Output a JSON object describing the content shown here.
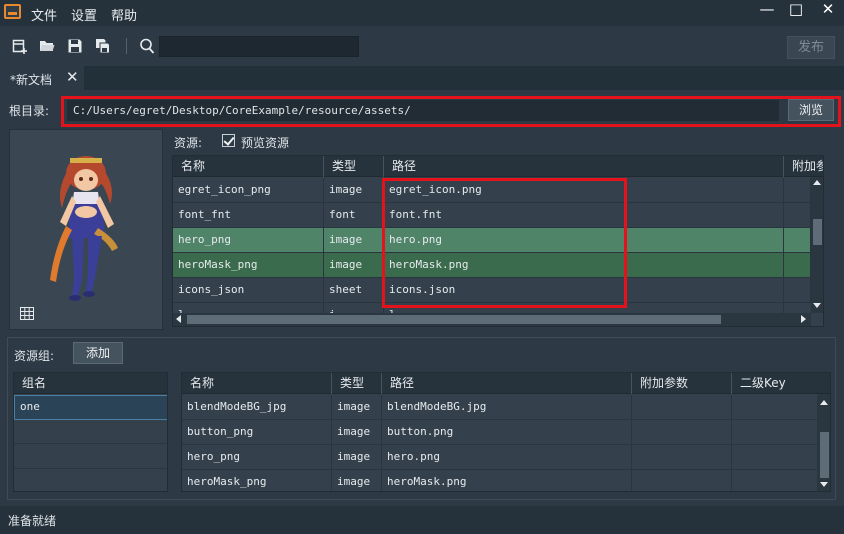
{
  "menu": {
    "file": "文件",
    "settings": "设置",
    "help": "帮助"
  },
  "window_controls": {
    "minimize": "—",
    "maximize": "□",
    "close": "✕"
  },
  "toolbar": {
    "icons": [
      "new-document-icon",
      "open-folder-icon",
      "save-icon",
      "save-all-icon",
      "search-icon"
    ],
    "search_value": "",
    "publish_label": "发布"
  },
  "tab": {
    "label": "*新文档",
    "close": "✕"
  },
  "root": {
    "label": "根目录:",
    "path": "C:/Users/egret/Desktop/CoreExample/resource/assets/",
    "browse_label": "浏览"
  },
  "resources": {
    "label": "资源:",
    "preview_label": "预览资源",
    "preview_checked": true,
    "columns": [
      "名称",
      "类型",
      "路径",
      "附加参"
    ],
    "rows": [
      {
        "name": "egret_icon_png",
        "type": "image",
        "path": "egret_icon.png",
        "state": "normal"
      },
      {
        "name": "font_fnt",
        "type": "font",
        "path": "font.fnt",
        "state": "normal"
      },
      {
        "name": "hero_png",
        "type": "image",
        "path": "hero.png",
        "state": "selected"
      },
      {
        "name": "heroMask_png",
        "type": "image",
        "path": "heroMask.png",
        "state": "highlight"
      },
      {
        "name": "icons_json",
        "type": "sheet",
        "path": "icons.json",
        "state": "normal"
      }
    ]
  },
  "groups": {
    "label": "资源组:",
    "add_label": "添加",
    "list_header": "组名",
    "items": [
      "one"
    ],
    "columns": [
      "名称",
      "类型",
      "路径",
      "附加参数",
      "二级Key"
    ],
    "rows": [
      {
        "name": "blendModeBG_jpg",
        "type": "image",
        "path": "blendModeBG.jpg"
      },
      {
        "name": "button_png",
        "type": "image",
        "path": "button.png"
      },
      {
        "name": "hero_png",
        "type": "image",
        "path": "hero.png"
      },
      {
        "name": "heroMask_png",
        "type": "image",
        "path": "heroMask.png"
      }
    ]
  },
  "status": {
    "text": "准备就绪"
  },
  "colors": {
    "accent_orange": "#e9892e",
    "highlight_red": "#e3121b",
    "selected_row": "#4f8469",
    "highlight_row": "#3a6b4c"
  }
}
